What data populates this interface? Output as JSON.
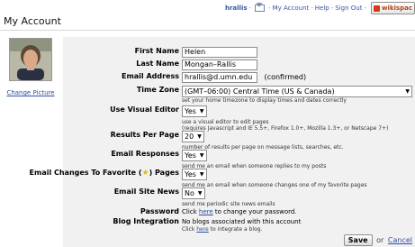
{
  "nav": {
    "username": "hrallis",
    "my_account": "My Account",
    "help": "Help",
    "sign_out": "Sign Out",
    "wiki_badge": "wikispac",
    "separator": "-"
  },
  "page": {
    "title": "My Account"
  },
  "left": {
    "change_picture": "Change Picture"
  },
  "form": {
    "first_name": {
      "label": "First Name",
      "value": "Helen"
    },
    "last_name": {
      "label": "Last Name",
      "value": "Mongan–Rallis"
    },
    "email": {
      "label": "Email Address",
      "value": "hrallis@d.umn.edu",
      "status": "(confirmed)"
    },
    "time_zone": {
      "label": "Time Zone",
      "value": "(GMT–06:00) Central Time (US & Canada)",
      "hint": "set your home timezone to display times and dates correctly"
    },
    "visual_editor": {
      "label": "Use Visual Editor",
      "value": "Yes",
      "hint1": "use a visual editor to edit pages",
      "hint2": "(requires Javascript and IE 5.5+, Firefox 1.0+, Mozilla 1.3+, or Netscape 7+)"
    },
    "results_per_page": {
      "label": "Results Per Page",
      "value": "20",
      "hint": "number of results per page on message lists, searches, etc."
    },
    "email_responses": {
      "label": "Email Responses",
      "value": "Yes",
      "hint": "send me an email when someone replies to my posts"
    },
    "email_changes": {
      "label_pre": "Email Changes To Favorite (",
      "label_post": ") Pages",
      "value": "Yes",
      "hint": "send me an email when someone changes one of my favorite pages"
    },
    "email_news": {
      "label": "Email Site News",
      "value": "No",
      "hint": "send me periodic site news emails"
    },
    "password": {
      "label": "Password",
      "pre": "Click ",
      "link": "here",
      "post": " to change your password."
    },
    "blog": {
      "label": "Blog Integration",
      "line1": "No blogs associated with this account",
      "pre": "Click ",
      "link": "here",
      "post": " to integrate a blog."
    }
  },
  "actions": {
    "save": "Save",
    "or": "or",
    "cancel": "Cancel"
  }
}
